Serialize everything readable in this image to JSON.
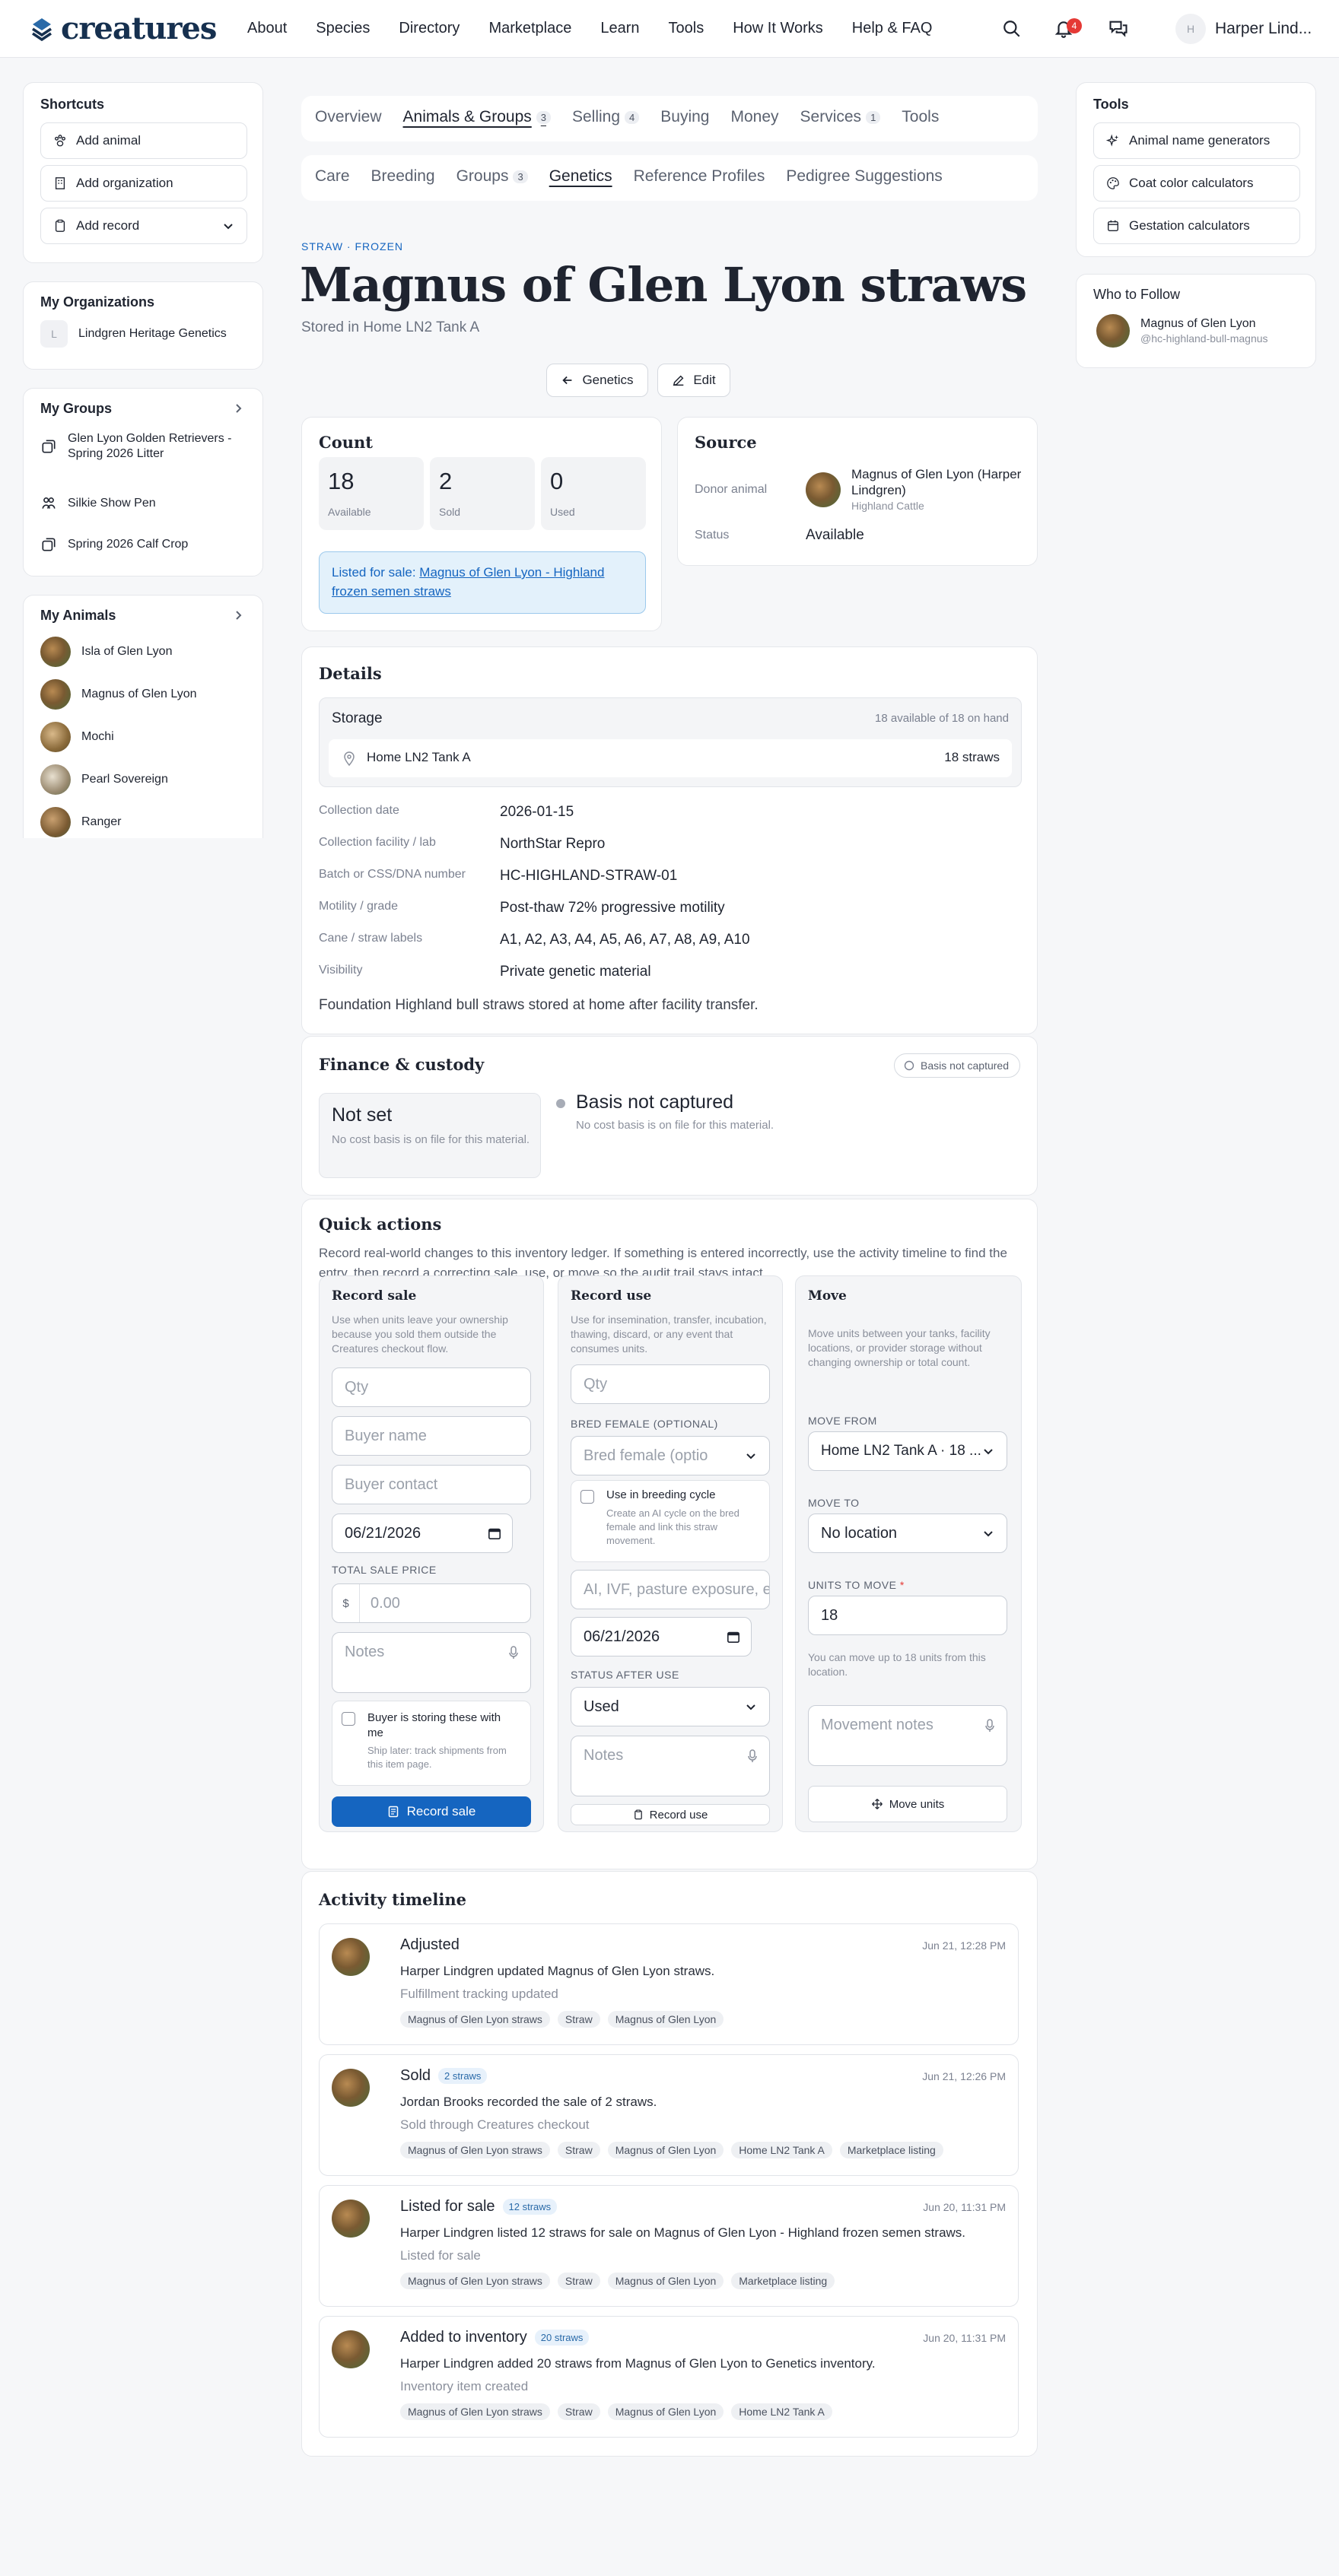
{
  "brand": {
    "name": "creatures"
  },
  "nav": [
    "About",
    "Species",
    "Directory",
    "Marketplace",
    "Learn",
    "Tools",
    "How It Works",
    "Help & FAQ"
  ],
  "header": {
    "notification_count": "4",
    "user_initial": "H",
    "user_name": "Harper Lind..."
  },
  "shortcuts": {
    "title": "Shortcuts",
    "items": [
      "Add animal",
      "Add organization",
      "Add record"
    ]
  },
  "organizations": {
    "title": "My Organizations",
    "items": [
      {
        "initial": "L",
        "name": "Lindgren Heritage Genetics"
      }
    ]
  },
  "groups": {
    "title": "My Groups",
    "items": [
      "Glen Lyon Golden Retrievers - Spring 2026 Litter",
      "Silkie Show Pen",
      "Spring 2026 Calf Crop"
    ]
  },
  "animals": {
    "title": "My Animals",
    "items": [
      "Isla of Glen Lyon",
      "Magnus of Glen Lyon",
      "Mochi",
      "Pearl Sovereign",
      "Ranger"
    ]
  },
  "right_tools": {
    "title": "Tools",
    "items": [
      "Animal name generators",
      "Coat color calculators",
      "Gestation calculators"
    ]
  },
  "follow": {
    "title": "Who to Follow",
    "name": "Magnus of Glen Lyon",
    "handle": "@hc-highland-bull-magnus"
  },
  "tabs": [
    {
      "label": "Overview",
      "count": ""
    },
    {
      "label": "Animals & Groups",
      "count": "3"
    },
    {
      "label": "Selling",
      "count": "4"
    },
    {
      "label": "Buying",
      "count": ""
    },
    {
      "label": "Money",
      "count": ""
    },
    {
      "label": "Services",
      "count": "1"
    },
    {
      "label": "Tools",
      "count": ""
    }
  ],
  "subtabs": [
    {
      "label": "Care",
      "count": ""
    },
    {
      "label": "Breeding",
      "count": ""
    },
    {
      "label": "Groups",
      "count": "3"
    },
    {
      "label": "Genetics",
      "count": ""
    },
    {
      "label": "Reference Profiles",
      "count": ""
    },
    {
      "label": "Pedigree Suggestions",
      "count": ""
    }
  ],
  "page": {
    "eyebrow": "STRAW · FROZEN",
    "title": "Magnus of Glen Lyon straws",
    "subtitle": "Stored in Home LN2 Tank A",
    "back_label": "Genetics",
    "edit_label": "Edit"
  },
  "count": {
    "title": "Count",
    "stats": [
      {
        "value": "18",
        "label": "Available"
      },
      {
        "value": "2",
        "label": "Sold"
      },
      {
        "value": "0",
        "label": "Used"
      }
    ],
    "listing_prefix": "Listed for sale: ",
    "listing_link": "Magnus of Glen Lyon - Highland frozen semen straws"
  },
  "source": {
    "title": "Source",
    "donor_label": "Donor animal",
    "donor_name": "Magnus of Glen Lyon (Harper Lindgren)",
    "donor_breed": "Highland Cattle",
    "status_label": "Status",
    "status_value": "Available"
  },
  "details": {
    "title": "Details",
    "storage_title": "Storage",
    "storage_summary": "18 available of 18 on hand",
    "location": "Home LN2 Tank A",
    "location_qty": "18 straws",
    "rows": [
      {
        "label": "Collection date",
        "value": "2026-01-15"
      },
      {
        "label": "Collection facility / lab",
        "value": "NorthStar Repro"
      },
      {
        "label": "Batch or CSS/DNA number",
        "value": "HC-HIGHLAND-STRAW-01"
      },
      {
        "label": "Motility / grade",
        "value": "Post-thaw 72% progressive motility"
      },
      {
        "label": "Cane / straw labels",
        "value": "A1, A2, A3, A4, A5, A6, A7, A8, A9, A10"
      },
      {
        "label": "Visibility",
        "value": "Private genetic material"
      }
    ],
    "note": "Foundation Highland bull straws stored at home after facility transfer."
  },
  "finance": {
    "title": "Finance & custody",
    "pill": "Basis not captured",
    "box_title": "Not set",
    "box_desc": "No cost basis is on file for this material.",
    "status_title": "Basis not captured",
    "status_desc": "No cost basis is on file for this material."
  },
  "quick": {
    "title": "Quick actions",
    "desc": "Record real-world changes to this inventory ledger. If something is entered incorrectly, use the activity timeline to find the entry, then record a correcting sale, use, or move so the audit trail stays intact.",
    "sale": {
      "title": "Record sale",
      "desc": "Use when units leave your ownership because you sold them outside the Creatures checkout flow.",
      "qty_ph": "Qty",
      "buyer_name_ph": "Buyer name",
      "buyer_contact_ph": "Buyer contact",
      "date": "06/21/2026",
      "price_label": "TOTAL SALE PRICE",
      "currency": "$",
      "price_ph": "0.00",
      "notes_ph": "Notes",
      "storing_label": "Buyer is storing these with me",
      "storing_desc": "Ship later: track shipments from this item page.",
      "submit": "Record sale"
    },
    "use": {
      "title": "Record use",
      "desc": "Use for insemination, transfer, incubation, thawing, discard, or any event that consumes units.",
      "qty_ph": "Qty",
      "female_label": "BRED FEMALE (OPTIONAL)",
      "female_ph": "Bred female (optio",
      "cycle_label": "Use in breeding cycle",
      "cycle_desc": "Create an AI cycle on the bred female and link this straw movement.",
      "method_ph": "AI, IVF, pasture exposure, e",
      "date": "06/21/2026",
      "status_label": "STATUS AFTER USE",
      "status_value": "Used",
      "notes_ph": "Notes",
      "submit": "Record use"
    },
    "move": {
      "title": "Move",
      "desc": "Move units between your tanks, facility locations, or provider storage without changing ownership or total count.",
      "from_label": "MOVE FROM",
      "from_value": "Home LN2 Tank A · 18 ...",
      "to_label": "MOVE TO",
      "to_value": "No location",
      "units_label": "UNITS TO MOVE",
      "required_mark": "*",
      "units_value": "18",
      "hint": "You can move up to 18 units from this location.",
      "notes_ph": "Movement notes",
      "submit": "Move units"
    }
  },
  "timeline": {
    "title": "Activity timeline",
    "items": [
      {
        "title": "Adjusted",
        "badge": "",
        "time": "Jun 21, 12:28 PM",
        "desc": "Harper Lindgren updated Magnus of Glen Lyon straws.",
        "sub": "Fulfillment tracking updated",
        "chips": [
          "Magnus of Glen Lyon straws",
          "Straw",
          "Magnus of Glen Lyon"
        ]
      },
      {
        "title": "Sold",
        "badge": "2 straws",
        "time": "Jun 21, 12:26 PM",
        "desc": "Jordan Brooks recorded the sale of 2 straws.",
        "sub": "Sold through Creatures checkout",
        "chips": [
          "Magnus of Glen Lyon straws",
          "Straw",
          "Magnus of Glen Lyon",
          "Home LN2 Tank A",
          "Marketplace listing"
        ]
      },
      {
        "title": "Listed for sale",
        "badge": "12 straws",
        "time": "Jun 20, 11:31 PM",
        "desc": "Harper Lindgren listed 12 straws for sale on Magnus of Glen Lyon - Highland frozen semen straws.",
        "sub": "Listed for sale",
        "chips": [
          "Magnus of Glen Lyon straws",
          "Straw",
          "Magnus of Glen Lyon",
          "Marketplace listing"
        ]
      },
      {
        "title": "Added to inventory",
        "badge": "20 straws",
        "time": "Jun 20, 11:31 PM",
        "desc": "Harper Lindgren added 20 straws from Magnus of Glen Lyon to Genetics inventory.",
        "sub": "Inventory item created",
        "chips": [
          "Magnus of Glen Lyon straws",
          "Straw",
          "Magnus of Glen Lyon",
          "Home LN2 Tank A"
        ]
      }
    ]
  },
  "colors": {
    "accent": "#1565c0",
    "brand": "#16304f",
    "notification": "#e53935",
    "listing_bg": "#e3f1fb",
    "page_bg": "#f6f7f9"
  }
}
